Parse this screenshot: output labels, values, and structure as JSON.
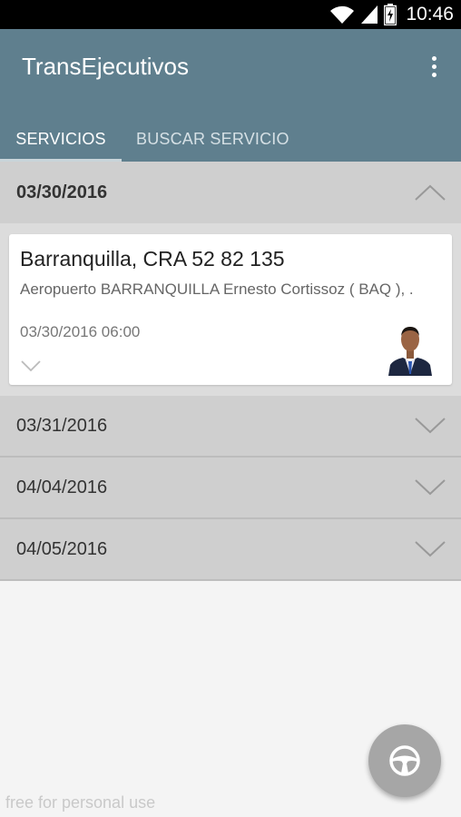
{
  "status_bar": {
    "time": "10:46",
    "icons": [
      "wifi-icon",
      "signal-icon",
      "battery-icon"
    ]
  },
  "app_bar": {
    "title": "TransEjecutivos",
    "overflow_icon": "more-vert-icon",
    "color": "#5f7f8e"
  },
  "tabs": [
    {
      "label": "SERVICIOS",
      "active": true
    },
    {
      "label": "BUSCAR SERVICIO",
      "active": false
    }
  ],
  "groups": [
    {
      "date": "03/30/2016",
      "expanded": true,
      "services": [
        {
          "destination": "Barranquilla, CRA 52 82 135",
          "origin": "Aeropuerto BARRANQUILLA Ernesto Cortissoz ( BAQ ), .",
          "datetime": "03/30/2016 06:00",
          "driver_photo": "driver-avatar"
        }
      ]
    },
    {
      "date": "03/31/2016",
      "expanded": false
    },
    {
      "date": "04/04/2016",
      "expanded": false
    },
    {
      "date": "04/05/2016",
      "expanded": false
    }
  ],
  "fab": {
    "icon": "steering-wheel-icon"
  },
  "watermark": "free for personal use"
}
